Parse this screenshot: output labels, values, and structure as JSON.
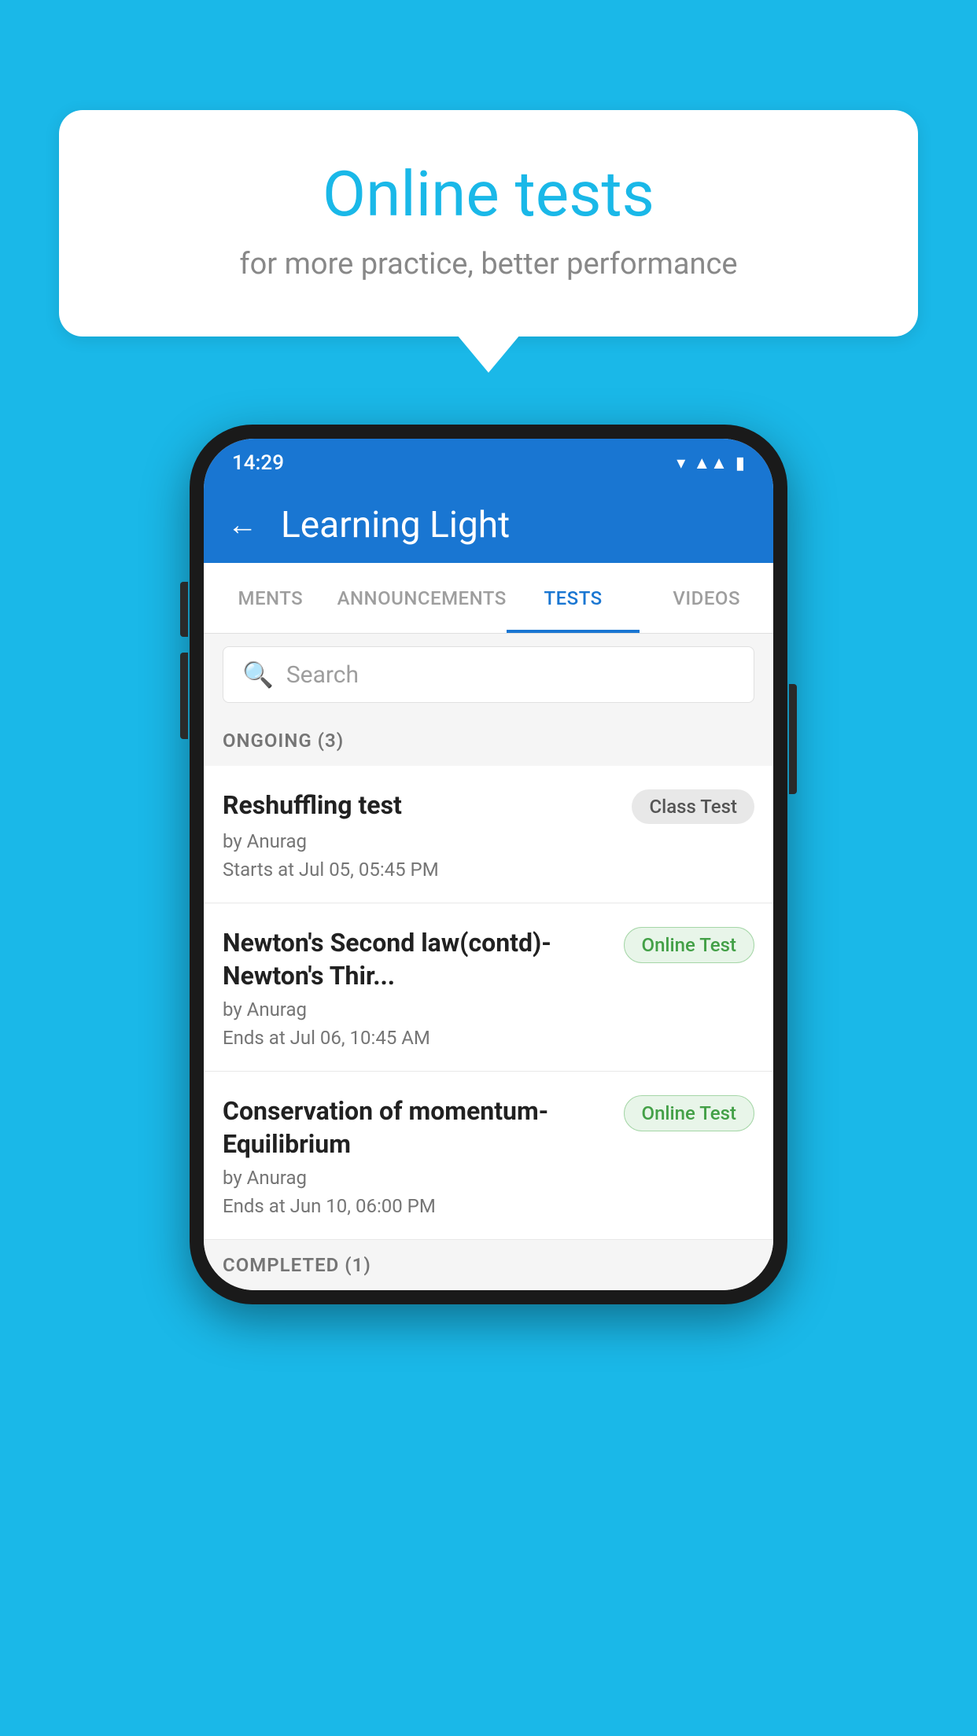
{
  "background_color": "#1ab8e8",
  "speech_bubble": {
    "title": "Online tests",
    "subtitle": "for more practice, better performance"
  },
  "phone": {
    "status_bar": {
      "time": "14:29",
      "icons": [
        "wifi",
        "signal",
        "battery"
      ]
    },
    "app_bar": {
      "title": "Learning Light",
      "back_label": "←"
    },
    "tabs": [
      {
        "label": "MENTS",
        "active": false
      },
      {
        "label": "ANNOUNCEMENTS",
        "active": false
      },
      {
        "label": "TESTS",
        "active": true
      },
      {
        "label": "VIDEOS",
        "active": false
      }
    ],
    "search": {
      "placeholder": "Search"
    },
    "ongoing_section": {
      "header": "ONGOING (3)",
      "items": [
        {
          "title": "Reshuffling test",
          "badge": "Class Test",
          "badge_type": "class",
          "by": "by Anurag",
          "date": "Starts at  Jul 05, 05:45 PM"
        },
        {
          "title": "Newton's Second law(contd)-Newton's Thir...",
          "badge": "Online Test",
          "badge_type": "online",
          "by": "by Anurag",
          "date": "Ends at  Jul 06, 10:45 AM"
        },
        {
          "title": "Conservation of momentum-Equilibrium",
          "badge": "Online Test",
          "badge_type": "online",
          "by": "by Anurag",
          "date": "Ends at  Jun 10, 06:00 PM"
        }
      ]
    },
    "completed_section": {
      "header": "COMPLETED (1)"
    }
  }
}
